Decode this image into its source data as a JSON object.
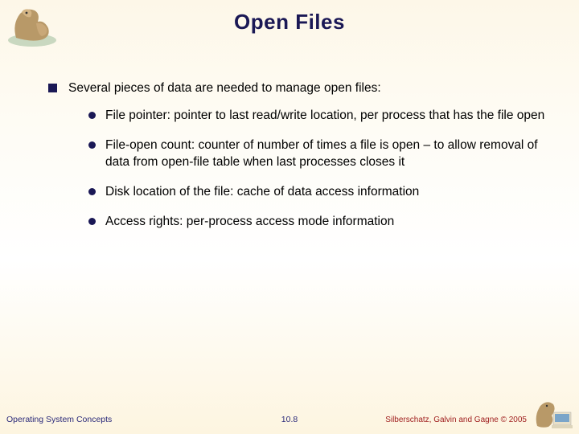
{
  "title": "Open Files",
  "main_bullet": "Several pieces of data are needed to manage open files:",
  "sub_bullets": [
    "File pointer:  pointer to last read/write location, per process that has the file open",
    "File-open count: counter of number of times a file is open – to allow removal of data from open-file table when last processes closes it",
    "Disk location of the file: cache of data access information",
    "Access rights: per-process access mode information"
  ],
  "footer": {
    "left": "Operating System Concepts",
    "center": "10.8",
    "right": "Silberschatz, Galvin and Gagne © 2005"
  }
}
